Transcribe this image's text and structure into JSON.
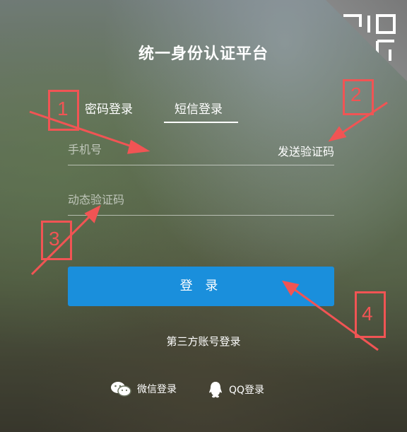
{
  "title": "统一身份认证平台",
  "tabs": [
    {
      "label": "密码登录",
      "active": false
    },
    {
      "label": "短信登录",
      "active": true
    }
  ],
  "form": {
    "phone_placeholder": "手机号",
    "send_code_label": "发送验证码",
    "code_placeholder": "动态验证码",
    "login_label": "登 录"
  },
  "third_party": {
    "heading": "第三方账号登录",
    "wechat_label": "微信登录",
    "qq_label": "QQ登录"
  },
  "annotations": [
    "1",
    "2",
    "3",
    "4"
  ],
  "colors": {
    "primary": "#1a8fdc",
    "annotation": "#f15454"
  },
  "icons": {
    "corner": "qr-code-icon",
    "wechat": "wechat-icon",
    "qq": "qq-icon"
  }
}
